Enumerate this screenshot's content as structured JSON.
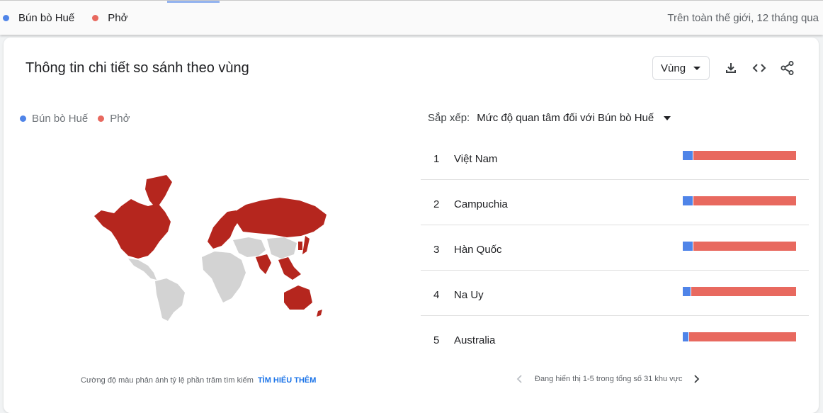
{
  "top_legend": {
    "terms": [
      {
        "label": "Bún bò Huế",
        "color": "#4f84e8"
      },
      {
        "label": "Phở",
        "color": "#e8695f"
      }
    ],
    "scope": "Trên toàn thế giới, 12 tháng qua"
  },
  "card": {
    "title": "Thông tin chi tiết so sánh theo vùng",
    "region_select": "Vùng",
    "icons": [
      "download-icon",
      "embed-code-icon",
      "share-icon"
    ]
  },
  "legend": [
    {
      "label": "Bún bò Huế",
      "color": "#4f84e8"
    },
    {
      "label": "Phở",
      "color": "#e8695f"
    }
  ],
  "map": {
    "highlight_color": "#b5261e",
    "other_color": "#d3d3d3",
    "caption": "Cường độ màu phản ánh tỷ lệ phần trăm tìm kiếm",
    "learn_more": "TÌM HIỂU THÊM"
  },
  "sort": {
    "label": "Sắp xếp:",
    "value": "Mức độ quan tâm đối với Bún bò Huế"
  },
  "regions": [
    {
      "rank": "1",
      "name": "Việt Nam",
      "share_a": 0.09
    },
    {
      "rank": "2",
      "name": "Campuchia",
      "share_a": 0.09
    },
    {
      "rank": "3",
      "name": "Hàn Quốc",
      "share_a": 0.09
    },
    {
      "rank": "4",
      "name": "Na Uy",
      "share_a": 0.07
    },
    {
      "rank": "5",
      "name": "Australia",
      "share_a": 0.05
    }
  ],
  "pager": {
    "text": "Đang hiển thị 1-5 trong tổng số 31 khu vực"
  }
}
